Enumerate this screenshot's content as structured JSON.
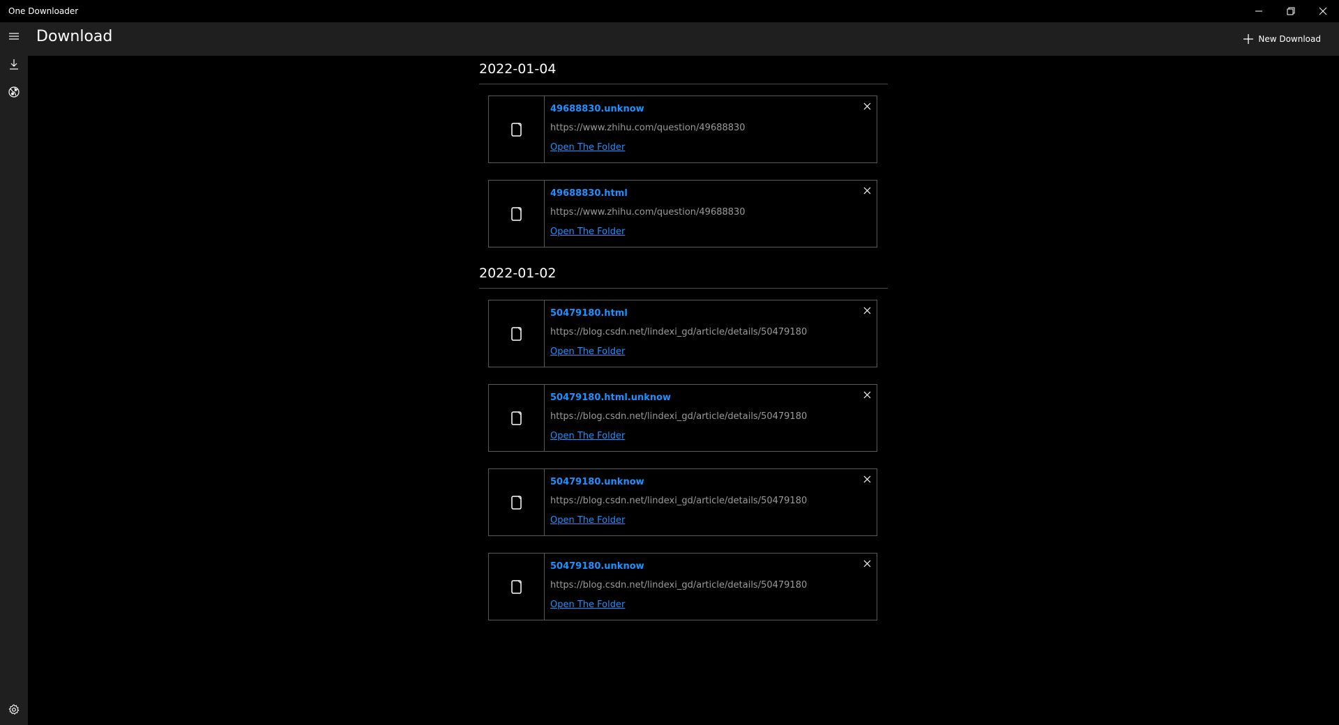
{
  "app": {
    "title": "One Downloader"
  },
  "header": {
    "page_title": "Download",
    "new_download_label": "New Download"
  },
  "sidebar": {
    "items": [
      {
        "icon": "hamburger-menu-icon"
      },
      {
        "icon": "download-icon"
      },
      {
        "icon": "globe-icon"
      }
    ],
    "footer": {
      "icon": "gear-icon"
    }
  },
  "groups": [
    {
      "date": "2022-01-04",
      "items": [
        {
          "name": "49688830.unknow",
          "url": "https://www.zhihu.com/question/49688830",
          "link": "Open The Folder"
        },
        {
          "name": "49688830.html",
          "url": "https://www.zhihu.com/question/49688830",
          "link": "Open The Folder"
        }
      ]
    },
    {
      "date": "2022-01-02",
      "items": [
        {
          "name": "50479180.html",
          "url": "https://blog.csdn.net/lindexi_gd/article/details/50479180",
          "link": "Open The Folder"
        },
        {
          "name": "50479180.html.unknow",
          "url": "https://blog.csdn.net/lindexi_gd/article/details/50479180",
          "link": "Open The Folder"
        },
        {
          "name": "50479180.unknow",
          "url": "https://blog.csdn.net/lindexi_gd/article/details/50479180",
          "link": "Open The Folder"
        },
        {
          "name": "50479180.unknow",
          "url": "https://blog.csdn.net/lindexi_gd/article/details/50479180",
          "link": "Open The Folder"
        }
      ]
    }
  ],
  "colors": {
    "accent": "#1e90ff",
    "background": "#000000",
    "chrome": "#1f1f1f",
    "url_text": "#9a9a9a"
  }
}
